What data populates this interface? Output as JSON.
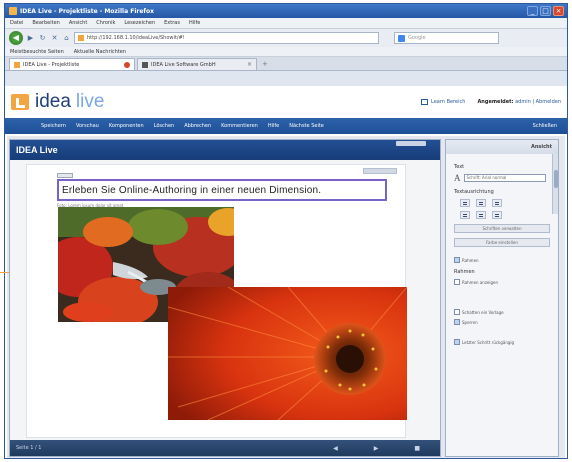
{
  "browser": {
    "title": "IDEA Live - Projektliste - Mozilla Firefox",
    "menu": [
      "Datei",
      "Bearbeiten",
      "Ansicht",
      "Chronik",
      "Lesezeichen",
      "Extras",
      "Hilfe"
    ],
    "url": "http://192.168.1.10/ideaLive/Showit/#!",
    "search_placeholder": "Google",
    "bookmarks": [
      "Meistbesuchte Seiten",
      "Aktuelle Nachrichten"
    ],
    "tabs": [
      {
        "label": "IDEA Live - Projektliste"
      },
      {
        "label": "IDEA Live Software GmbH"
      }
    ]
  },
  "app": {
    "brand_part1": "idea",
    "brand_part2": "live",
    "learn_label": "Learn Bereich",
    "login_label": "Angemeldet:",
    "login_user": "admin | Abmelden",
    "menu": [
      "Speichern",
      "Vorschau",
      "Komponenten",
      "Löschen",
      "Abbrechen",
      "Kommentieren",
      "Hilfe",
      "Nächste Seite"
    ],
    "menu_right": "Schließen"
  },
  "editor": {
    "title": "IDEA Live",
    "headline": "Erleben Sie Online-Authoring in einer neuen Dimension.",
    "caption": "Foto: Lorem ipsum dolor sit amet",
    "footer_page": "Seite 1 / 1",
    "footer_controls": [
      "◀",
      "▶",
      "■"
    ]
  },
  "sidebar": {
    "title": "Ansicht",
    "font_label": "Text",
    "font_value": "Schrift: Arial normal",
    "align_label": "Textausrichtung",
    "btn1": "Schriften verwalten",
    "btn2": "Farbe einstellen",
    "chk_frame": "Rahmen",
    "section2": "Rahmen",
    "chk_frame2": "Rahmen anzeigen",
    "chk_shadow": "Schatten ein Vorlage",
    "chk_lock": "Sperren",
    "chk_last": "Letzter Schritt rückgängig"
  },
  "colors": {
    "accent": "#1f4f96",
    "brand": "#f2a541",
    "textbox_border": "#7763c9"
  }
}
